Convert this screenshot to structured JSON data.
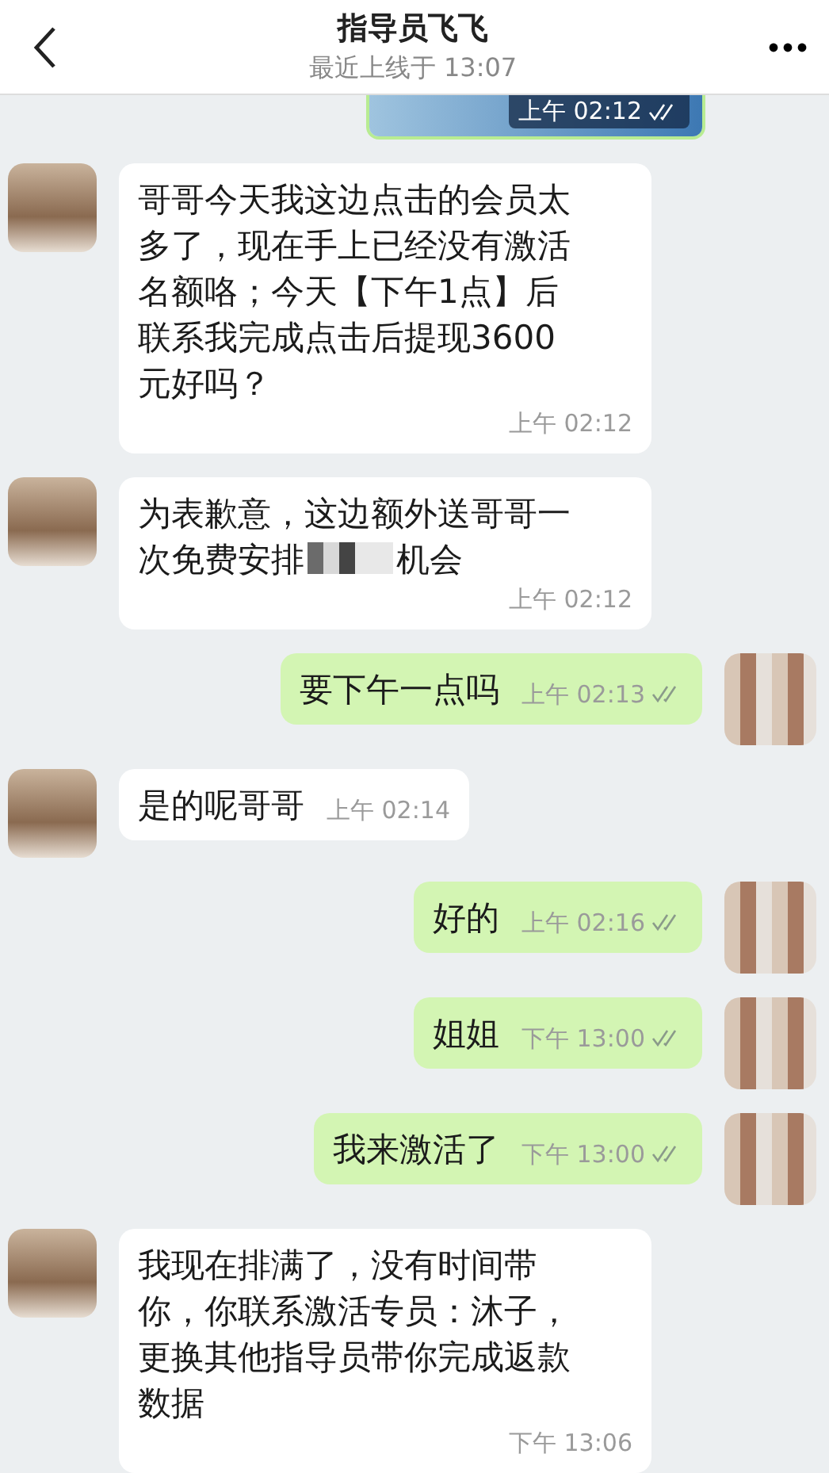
{
  "header": {
    "title": "指导员飞飞",
    "status": "最近上线于 13:07"
  },
  "messages": [
    {
      "kind": "outgoing-image",
      "time": "上午 02:12"
    },
    {
      "kind": "incoming-text",
      "text": "哥哥今天我这边点击的会员太多了，现在手上已经没有激活名额咯；今天【下午1点】后联系我完成点击后提现3600元好吗？",
      "time": "上午 02:12"
    },
    {
      "kind": "incoming-redacted",
      "text": "为表歉意，这边额外送哥哥一次免费安排",
      "text_after": "机会",
      "time": "上午 02:12"
    },
    {
      "kind": "outgoing-text",
      "text": "要下午一点吗",
      "time": "上午 02:13"
    },
    {
      "kind": "incoming-text",
      "text": "是的呢哥哥",
      "time": "上午 02:14"
    },
    {
      "kind": "outgoing-text",
      "text": "好的",
      "time": "上午 02:16"
    },
    {
      "kind": "outgoing-text",
      "text": "姐姐",
      "time": "下午 13:00"
    },
    {
      "kind": "outgoing-text",
      "text": "我来激活了",
      "time": "下午 13:00"
    },
    {
      "kind": "incoming-text",
      "text": "我现在排满了，没有时间带你，你联系激活专员：沐子，更换其他指导员带你完成返款数据",
      "time": "下午 13:06"
    }
  ]
}
